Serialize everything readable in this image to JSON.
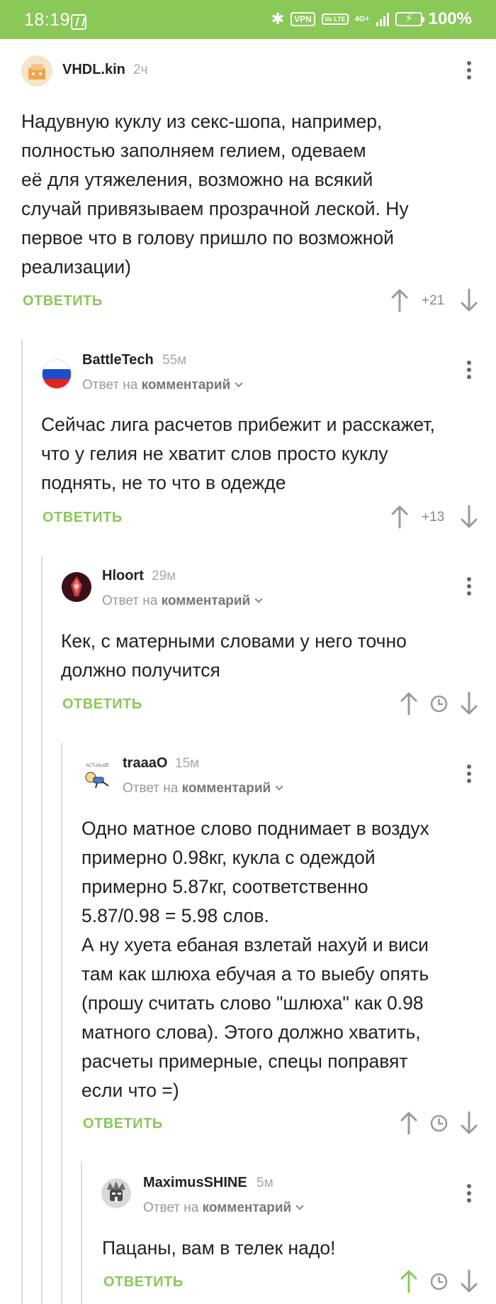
{
  "status_bar": {
    "time": "18:19",
    "nfc_icon": "N",
    "bluetooth_icon": "✱",
    "vpn": "VPN",
    "volte": "Vo LTE",
    "network": "4G+",
    "battery_percent": "100%"
  },
  "colors": {
    "accent": "#8ac858",
    "username": "#222222",
    "meta": "#a8a8a8",
    "thread_line": "#dcdcdc"
  },
  "comments": [
    {
      "username": "VHDL.kin",
      "time": "2ч",
      "reply_to": null,
      "text": "Надувную куклу из секс-шопа, например,\nполностью заполняем гелием, одеваем\nеё для утяжеления, возможно на всякий\nслучай привязываем прозрачной леской.  Ну\nпервое что в голову пришло по возможной\nреализации)",
      "reply_label": "ОТВЕТИТЬ",
      "rating": "+21"
    },
    {
      "username": "BattleTech",
      "time": "55м",
      "reply_to": {
        "prefix": "Ответ на",
        "link": "комментарий"
      },
      "text": "Сейчас лига расчетов прибежит и расскажет,\nчто у гелия не хватит слов просто куклу\nподнять, не то что в одежде",
      "reply_label": "ОТВЕТИТЬ",
      "rating": "+13"
    },
    {
      "username": "Hloort",
      "time": "29м",
      "reply_to": {
        "prefix": "Ответ на",
        "link": "комментарий"
      },
      "text": "Кек, с матерными словами у него точно\nдолжно получится",
      "reply_label": "ОТВЕТИТЬ",
      "rating": null
    },
    {
      "username": "traaaO",
      "time": "15м",
      "reply_to": {
        "prefix": "Ответ на",
        "link": "комментарий"
      },
      "text": "Одно матное слово поднимает в воздух\nпримерно 0.98кг, кукла с одеждой\nпримерно 5.87кг, соответственно\n5.87/0.98 = 5.98 слов.\nА ну хуета ебаная взлетай нахуй и виси\nтам как шлюха ебучая а то выебу опять\n(прошу считать слово \"шлюха\" как 0.98\nматного слова). Этого должно хватить,\nрасчеты примерные, спецы поправят\nесли что =)",
      "reply_label": "ОТВЕТИТЬ",
      "rating": null
    },
    {
      "username": "MaximusSHINE",
      "time": "5м",
      "reply_to": {
        "prefix": "Ответ на",
        "link": "комментарий"
      },
      "text": "Пацаны, вам в телек надо!",
      "reply_label": "ОТВЕТИТЬ",
      "rating": null,
      "upvoted": true
    }
  ]
}
